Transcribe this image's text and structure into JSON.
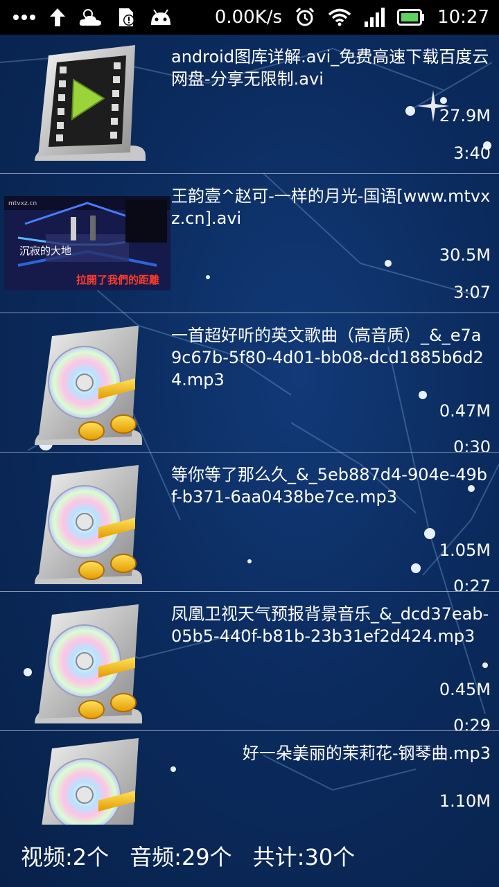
{
  "status_bar": {
    "network_speed": "0.00K/s",
    "time": "10:27",
    "left_icons": [
      "more-dots-icon",
      "upload-arrow-icon",
      "cloud-weather-icon",
      "sd-card-alert-icon",
      "android-icon"
    ],
    "right_icons": [
      "alarm-clock-icon",
      "wifi-icon",
      "signal-icon",
      "battery-icon"
    ]
  },
  "files": [
    {
      "type": "video",
      "icon": "video-file-icon",
      "title": "android图库详解.avi_免费高速下载百度云 网盘-分享无限制.avi",
      "size": "27.9M",
      "duration": "3:40"
    },
    {
      "type": "video",
      "icon": "video-thumbnail",
      "title": "王韵壹^赵可-一样的月光-国语[www.mtvxz.cn].avi",
      "size": "30.5M",
      "duration": "3:07",
      "thumb_text_top": "mtvxz.cn",
      "thumb_text_left": "沉寂的大地",
      "thumb_text_bottom": "拉開了我們的距離"
    },
    {
      "type": "audio",
      "icon": "audio-file-icon",
      "title": "一首超好听的英文歌曲（高音质）_&_e7a9c67b-5f80-4d01-bb08-dcd1885b6d24.mp3",
      "size": "0.47M",
      "duration": "0:30"
    },
    {
      "type": "audio",
      "icon": "audio-file-icon",
      "title": "等你等了那么久_&_5eb887d4-904e-49bf-b371-6aa0438be7ce.mp3",
      "size": "1.05M",
      "duration": "0:27"
    },
    {
      "type": "audio",
      "icon": "audio-file-icon",
      "title": "凤凰卫视天气预报背景音乐_&_dcd37eab-05b5-440f-b81b-23b31ef2d424.mp3",
      "size": "0.45M",
      "duration": "0:29"
    },
    {
      "type": "audio",
      "icon": "audio-file-icon",
      "title": "好一朵美丽的茉莉花-钢琴曲.mp3",
      "size": "1.10M",
      "duration": ""
    }
  ],
  "footer": {
    "video_count": "视频:2个",
    "audio_count": "音频:29个",
    "total_count": "共计:30个"
  },
  "colors": {
    "background": "#0b2b5e",
    "divider": "#c8d2e6",
    "status_bar": "#000000",
    "battery": "#5fd35f"
  }
}
